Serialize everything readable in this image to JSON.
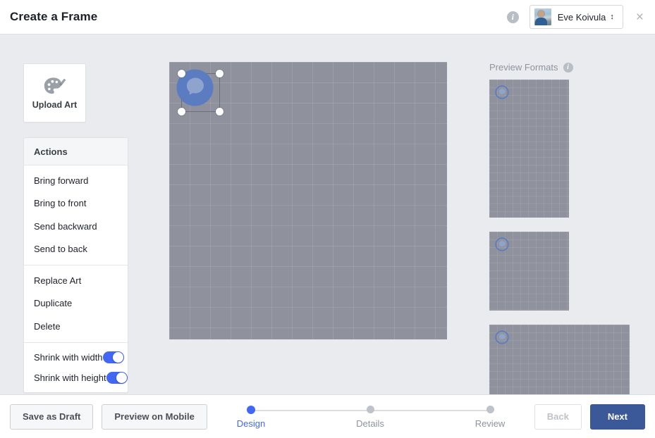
{
  "header": {
    "title": "Create a Frame",
    "info_icon": "info-icon",
    "user_name": "Eve Koivula",
    "user_caret": "↕",
    "close_icon": "×"
  },
  "upload": {
    "label": "Upload Art",
    "icon": "palette-icon"
  },
  "actions": {
    "title": "Actions",
    "groups": [
      {
        "items": [
          {
            "label": "Bring forward"
          },
          {
            "label": "Bring to front"
          },
          {
            "label": "Send backward"
          },
          {
            "label": "Send to back"
          }
        ]
      },
      {
        "items": [
          {
            "label": "Replace Art"
          },
          {
            "label": "Duplicate"
          },
          {
            "label": "Delete"
          }
        ]
      }
    ],
    "toggles": [
      {
        "label": "Shrink with width",
        "state": "on"
      },
      {
        "label": "Shrink with height",
        "state": "on"
      }
    ]
  },
  "canvas": {
    "name": "frame-design-canvas",
    "background_color": "#8f929d",
    "grid_size_px": 29,
    "selected_art": "messenger-logo-art",
    "handles": [
      "top-left",
      "top-right",
      "bottom-left",
      "bottom-right"
    ]
  },
  "preview": {
    "title": "Preview Formats",
    "info_icon": "info-icon",
    "thumbnails": [
      {
        "name": "portrait-preview",
        "format": "portrait"
      },
      {
        "name": "square-preview",
        "format": "square"
      },
      {
        "name": "landscape-preview",
        "format": "landscape"
      }
    ]
  },
  "footer": {
    "save_draft_label": "Save as Draft",
    "preview_mobile_label": "Preview on Mobile",
    "back_label": "Back",
    "next_label": "Next",
    "steps": [
      {
        "label": "Design",
        "state": "active"
      },
      {
        "label": "Details",
        "state": "inactive"
      },
      {
        "label": "Review",
        "state": "inactive"
      }
    ]
  },
  "colors": {
    "accent_blue": "#4267f2",
    "brand_blue": "#3b5998",
    "page_background": "#e9ebee",
    "canvas_gray": "#8f929d"
  }
}
